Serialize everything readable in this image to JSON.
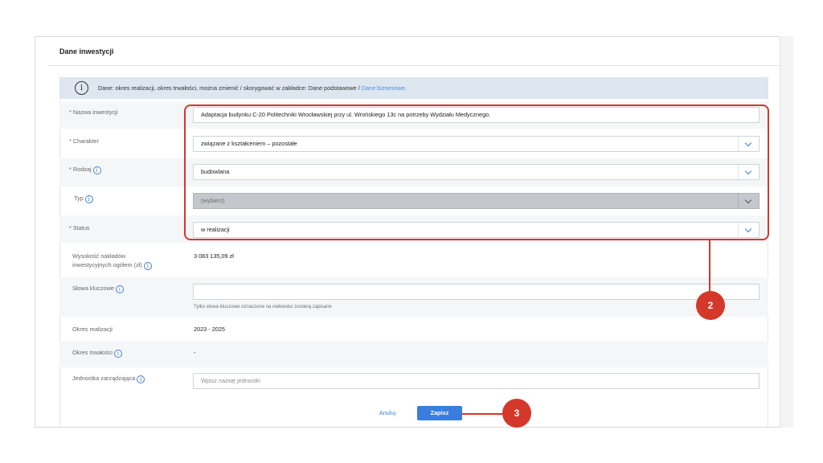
{
  "card": {
    "title": "Dane inwestycji"
  },
  "info": {
    "icon": "info-circle-icon",
    "text": "Dane: okres realizacji, okres trwałości, można zmienić / skorygować w zakładce: Dane podstawowe / ",
    "link": "Dane biznesowe",
    "end": "."
  },
  "fields": {
    "nazwa": {
      "label": "Nazwa inwestycji",
      "required": "*",
      "value": "Adaptacja  budynku C-20 Politechniki Wrocławskiej przy ul. Wrońskiego 13c na potrzeby Wydziału Medycznego."
    },
    "charakter": {
      "label": "Charakter",
      "required": "*",
      "value": "związane z kształceniem – pozostałe"
    },
    "rodzaj": {
      "label": "Rodzaj",
      "required": "*",
      "value": "budowlana"
    },
    "typ": {
      "label": "Typ",
      "value": "(wybierz)"
    },
    "status": {
      "label": "Status",
      "required": "*",
      "value": "w realizacji"
    },
    "wysokosc": {
      "label_line1": "Wysokość nakładów",
      "label_line2": "inwestycyjnych ogółem (zł)",
      "value": "3 083 135,09 zł"
    },
    "slowa": {
      "label": "Słowa kluczowe",
      "value": "",
      "helper": "Tylko słowa kluczowe oznaczone na niebiesko zostaną zapisane"
    },
    "okres_realizacji": {
      "label": "Okres realizacji",
      "value": "2023 - 2025"
    },
    "okres_trwalosci": {
      "label": "Okres trwałości",
      "value": "-"
    },
    "jednostka": {
      "label": "Jednostka zarządzająca",
      "placeholder": "Wpisz nazwę jednostki"
    }
  },
  "info_icon_glyph": "i",
  "actions": {
    "cancel": "Anuluj",
    "save": "Zapisz"
  },
  "callouts": {
    "two": "2",
    "three": "3"
  },
  "colors": {
    "accent": "#3b7ddd",
    "highlight": "#d4382a",
    "info_bg": "#dee6f0"
  }
}
